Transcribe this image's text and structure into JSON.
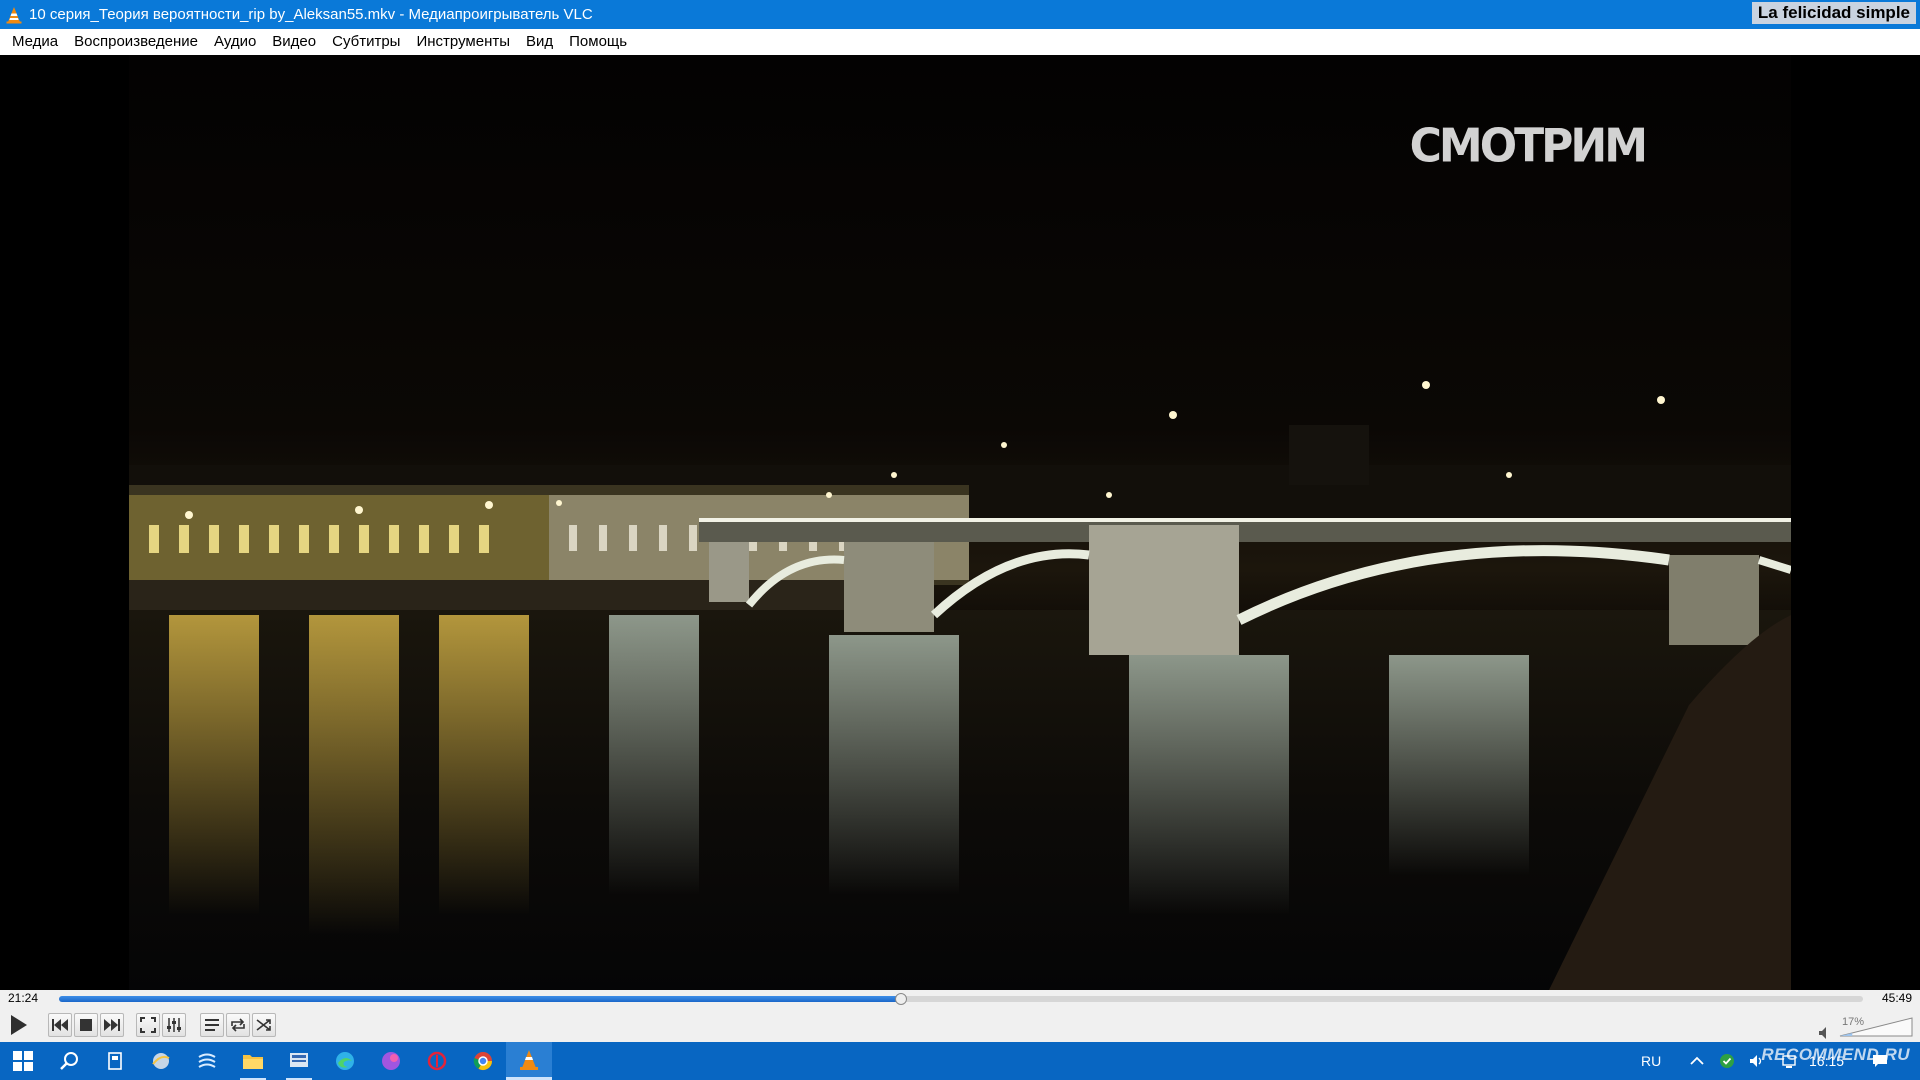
{
  "window": {
    "title": "10 серия_Теория вероятности_rip by_Aleksan55.mkv - Медиапроигрыватель VLC",
    "overlay_text": "La felicidad simple",
    "app_icon": "vlc-cone-icon"
  },
  "menu": {
    "items": [
      "Медиа",
      "Воспроизведение",
      "Аудио",
      "Видео",
      "Субтитры",
      "Инструменты",
      "Вид",
      "Помощь"
    ]
  },
  "video": {
    "watermark": "СМОТРИМ",
    "scene": "night-bridge-river"
  },
  "playback": {
    "elapsed": "21:24",
    "total": "45:49",
    "progress": 0.467
  },
  "controls": {
    "buttons": [
      "play-icon",
      "previous-icon",
      "stop-icon",
      "next-icon",
      "fullscreen-icon",
      "extended-settings-icon",
      "playlist-icon",
      "loop-icon",
      "shuffle-icon"
    ],
    "volume_label": "17%",
    "volume": 0.17
  },
  "taskbar": {
    "apps": [
      "windows-start-icon",
      "search-icon",
      "task-view-icon",
      "app-icon",
      "app-icon",
      "file-explorer-icon",
      "app-icon",
      "edge-icon",
      "app-icon",
      "app-icon",
      "chrome-icon",
      "vlc-icon"
    ],
    "active_app": "vlc-icon",
    "language": "RU",
    "clock": "16:15",
    "watermark": "RECOMMEND.RU"
  },
  "colors": {
    "titlebar": "#0a79d8",
    "taskbar": "#0866c2",
    "seek_fill": "#1a67c9"
  }
}
